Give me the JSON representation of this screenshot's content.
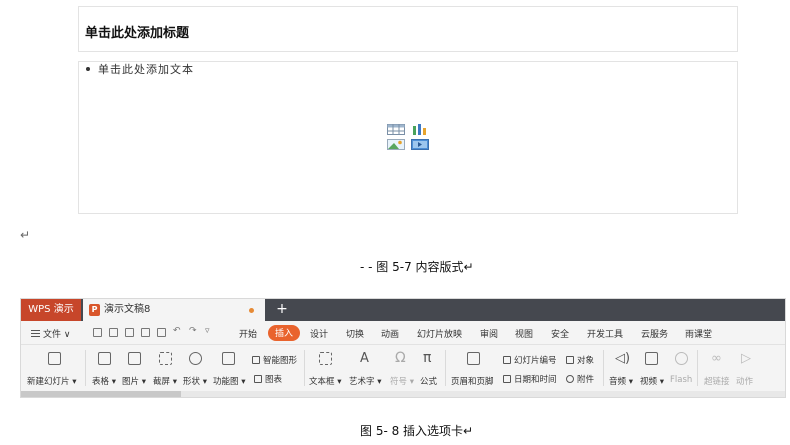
{
  "slide": {
    "title_placeholder": "单击此处添加标题",
    "content_placeholder": "单击此处添加文本",
    "placeholder_icons": [
      "table-icon",
      "chart-icon",
      "picture-icon",
      "media-icon"
    ]
  },
  "marks": {
    "paragraph_return": "↵"
  },
  "captions": {
    "figure_5_7": "- - 图 5-7 内容版式↵",
    "figure_5_8": "图 5- 8 插入选项卡↵"
  },
  "ribbon": {
    "app_tab": "WPS 演示",
    "doc_tab": "演示文稿8",
    "doc_icon_letter": "P",
    "new_tab_symbol": "+",
    "file_menu": "文件 ∨",
    "menu_tabs": [
      "开始",
      "插入",
      "设计",
      "切换",
      "动画",
      "幻灯片放映",
      "审阅",
      "视图",
      "安全",
      "开发工具",
      "云服务",
      "雨课堂"
    ],
    "active_tab": "插入",
    "tools": {
      "new_slide": "新建幻灯片 ▾",
      "table": "表格 ▾",
      "picture": "图片 ▾",
      "screenshot": "截屏 ▾",
      "shapes": "形状 ▾",
      "function_chart": "功能图 ▾",
      "smart_graphic": "智能图形",
      "chart": "图表",
      "textbox": "文本框 ▾",
      "wordart": "艺术字 ▾",
      "symbol": "符号 ▾",
      "formula": "公式",
      "header_footer": "页眉和页脚",
      "slide_number": "幻灯片编号",
      "object": "对象",
      "date_time": "日期和时间",
      "attachment": "附件",
      "audio": "音频 ▾",
      "video": "视频 ▾",
      "flash": "Flash",
      "hyperlink": "超链接",
      "action": "动作"
    },
    "colors": {
      "accent": "#e9632d",
      "app_tab": "#c7462a",
      "titlebar": "#45484f"
    }
  }
}
